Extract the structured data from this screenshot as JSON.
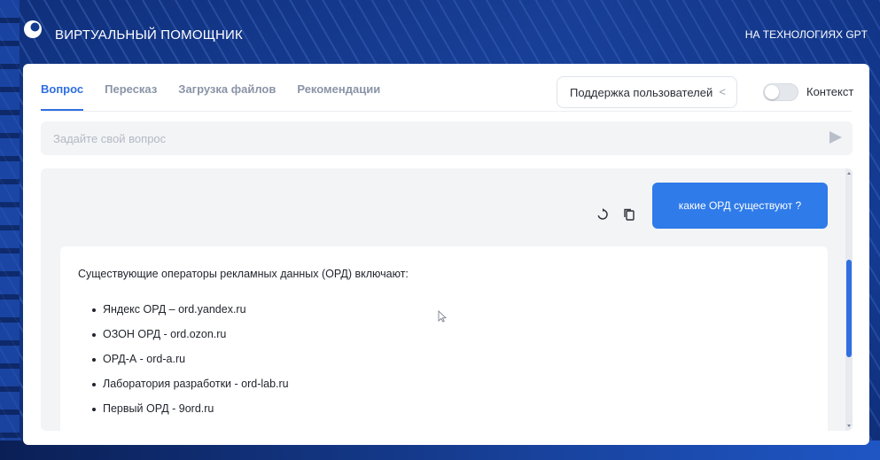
{
  "header": {
    "brand": "ВИРТУАЛЬНЫЙ ПОМОЩНИК",
    "tagline": "НА ТЕХНОЛОГИЯХ GPT",
    "logo_icon": "brand-logo-icon"
  },
  "tabs": [
    {
      "label": "Вопрос",
      "active": true
    },
    {
      "label": "Пересказ",
      "active": false
    },
    {
      "label": "Загрузка файлов",
      "active": false
    },
    {
      "label": "Рекомендации",
      "active": false
    }
  ],
  "category_select": {
    "value": "Поддержка пользователей",
    "icon": "chevron-left-icon"
  },
  "context_toggle": {
    "label": "Контекст",
    "on": false
  },
  "question_input": {
    "placeholder": "Задайте свой вопрос",
    "value": "",
    "send_icon": "send-icon"
  },
  "chat": {
    "user_message": "какие ОРД существуют ?",
    "message_actions": [
      "refresh-icon",
      "copy-icon"
    ],
    "answer": {
      "intro": "Существующие операторы рекламных данных (ОРД) включают:",
      "items": [
        "Яндекс ОРД – ord.yandex.ru",
        "ОЗОН ОРД - ord.ozon.ru",
        "ОРД-А - ord-a.ru",
        "Лаборатория разработки - ord-lab.ru",
        "Первый ОРД - 9ord.ru"
      ]
    }
  },
  "colors": {
    "accent": "#2f6fe0",
    "user_bubble": "#2f7be9",
    "panel_bg": "#ffffff",
    "field_bg": "#f3f4f6"
  }
}
